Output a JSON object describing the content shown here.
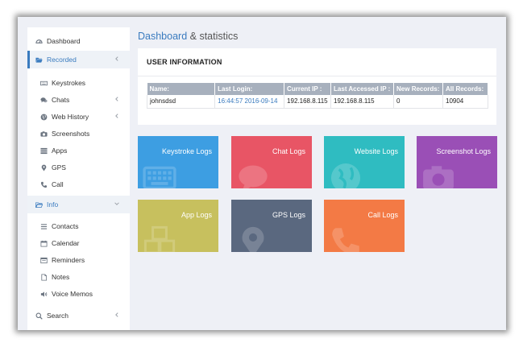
{
  "sidebar": {
    "dashboard": {
      "label": "Dashboard",
      "icon": "dashboard-icon"
    },
    "recorded": {
      "label": "Recorded",
      "icon": "folder-open-icon",
      "items": [
        {
          "label": "Keystrokes",
          "icon": "keyboard-icon"
        },
        {
          "label": "Chats",
          "icon": "comments-icon"
        },
        {
          "label": "Web History",
          "icon": "globe-icon"
        },
        {
          "label": "Screenshots",
          "icon": "camera-icon"
        },
        {
          "label": "Apps",
          "icon": "apps-icon"
        },
        {
          "label": "GPS",
          "icon": "map-marker-icon"
        },
        {
          "label": "Call",
          "icon": "phone-icon"
        }
      ]
    },
    "info": {
      "label": "Info",
      "icon": "folder-open-icon",
      "items": [
        {
          "label": "Contacts",
          "icon": "list-icon"
        },
        {
          "label": "Calendar",
          "icon": "calendar-icon"
        },
        {
          "label": "Reminders",
          "icon": "reminder-icon"
        },
        {
          "label": "Notes",
          "icon": "note-icon"
        },
        {
          "label": "Voice Memos",
          "icon": "volume-icon"
        }
      ]
    },
    "search": {
      "label": "Search",
      "icon": "search-icon"
    }
  },
  "header": {
    "title_main": "Dashboard",
    "title_rest": "& statistics"
  },
  "user_info": {
    "heading": "USER INFORMATION",
    "columns": [
      "Name:",
      "Last Login:",
      "Current IP :",
      "Last Accessed IP :",
      "New Records:",
      "All Records:"
    ],
    "row": [
      "johnsdsd",
      "16:44:57 2016-09-14",
      "192.168.8.115",
      "192.168.8.115",
      "0",
      "10904"
    ]
  },
  "tiles": [
    {
      "label": "Keystroke Logs",
      "color": "#3d9ee2",
      "icon": "keyboard-icon"
    },
    {
      "label": "Chat Logs",
      "color": "#e85565",
      "icon": "chat-icon"
    },
    {
      "label": "Website Logs",
      "color": "#2fbcc1",
      "icon": "globe-icon"
    },
    {
      "label": "Screenshot Logs",
      "color": "#9a4fb6",
      "icon": "camera-icon"
    },
    {
      "label": "App Logs",
      "color": "#c7c05e",
      "icon": "cubes-icon"
    },
    {
      "label": "GPS Logs",
      "color": "#5a687f",
      "icon": "map-marker-icon"
    },
    {
      "label": "Call Logs",
      "color": "#f37a45",
      "icon": "phone-icon"
    }
  ]
}
